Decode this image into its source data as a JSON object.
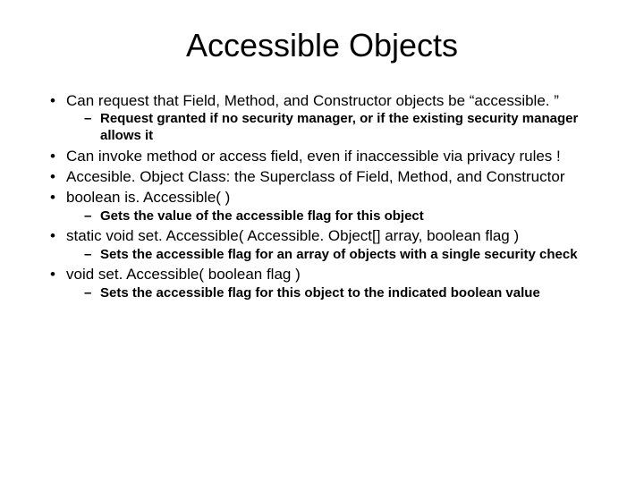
{
  "title": "Accessible Objects",
  "bullets": {
    "b1": "Can request that Field, Method, and Constructor objects be “accessible. ”",
    "b1_sub1": "Request granted if no security manager, or if the existing security manager allows it",
    "b2": "Can invoke method or access field, even if inaccessible via privacy rules !",
    "b3": "Accesible. Object Class:  the Superclass of Field, Method, and Constructor",
    "b4": "boolean is. Accessible( )",
    "b4_sub1": "Gets the value of the accessible flag for this object",
    "b5": "static void set. Accessible( Accessible. Object[] array, boolean flag )",
    "b5_sub1": "Sets the accessible flag for an array of objects with a single security check",
    "b6": "void set. Accessible( boolean flag )",
    "b6_sub1": "Sets the accessible flag for this object to the indicated boolean value"
  }
}
